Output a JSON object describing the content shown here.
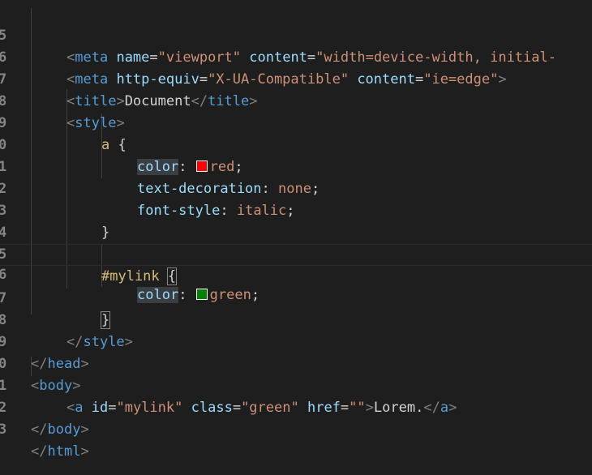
{
  "editor": {
    "colors": {
      "swatch_red": "#ff0000",
      "swatch_green": "#008000"
    },
    "lines": [
      {
        "num": "5",
        "parts": [
          "<",
          "meta",
          " ",
          "name",
          "=",
          "\"viewport\"",
          " ",
          "content",
          "=",
          "\"width=device-width, initial-"
        ]
      },
      {
        "num": "6",
        "parts": [
          "<",
          "meta",
          " ",
          "http-equiv",
          "=",
          "\"X-UA-Compatible\"",
          " ",
          "content",
          "=",
          "\"ie=edge\"",
          ">"
        ]
      },
      {
        "num": "7",
        "parts": [
          "<",
          "title",
          ">",
          "Document",
          "</",
          "title",
          ">"
        ]
      },
      {
        "num": "8",
        "parts": [
          "<",
          "style",
          ">"
        ]
      },
      {
        "num": "9",
        "parts": [
          "a",
          " {"
        ]
      },
      {
        "num": "0",
        "parts": [
          "color",
          ": ",
          "red",
          ";"
        ]
      },
      {
        "num": "1",
        "parts": [
          "text-decoration",
          ": ",
          "none",
          ";"
        ]
      },
      {
        "num": "2",
        "parts": [
          "font-style",
          ": ",
          "italic",
          ";"
        ]
      },
      {
        "num": "3",
        "parts": [
          "}"
        ]
      },
      {
        "num": "4",
        "parts": []
      },
      {
        "num": "5",
        "parts": [
          "#mylink",
          " ",
          "{"
        ]
      },
      {
        "num": "6",
        "parts": [
          "color",
          ": ",
          "green",
          ";"
        ]
      },
      {
        "num": "7",
        "parts": [
          "}"
        ]
      },
      {
        "num": "8",
        "parts": [
          "</",
          "style",
          ">"
        ]
      },
      {
        "num": "9",
        "parts": [
          "</",
          "head",
          ">"
        ]
      },
      {
        "num": "0",
        "parts": [
          "<",
          "body",
          ">"
        ]
      },
      {
        "num": "1",
        "parts": [
          "<",
          "a",
          " ",
          "id",
          "=",
          "\"mylink\"",
          " ",
          "class",
          "=",
          "\"green\"",
          " ",
          "href",
          "=",
          "\"\"",
          ">",
          "Lorem.",
          "</",
          "a",
          ">"
        ]
      },
      {
        "num": "2",
        "parts": [
          "</",
          "body",
          ">"
        ]
      },
      {
        "num": "3",
        "parts": [
          "</",
          "html",
          ">"
        ]
      }
    ]
  }
}
